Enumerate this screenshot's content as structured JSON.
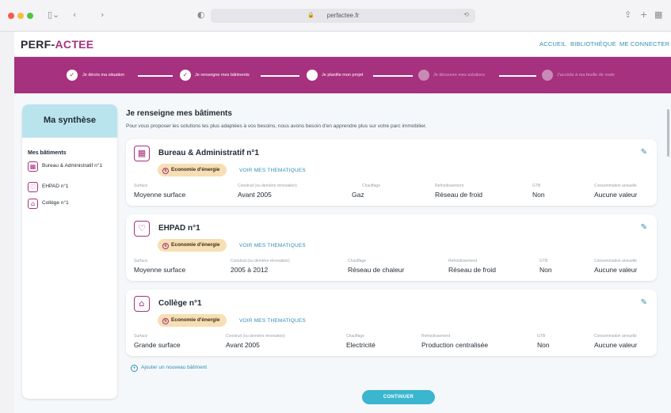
{
  "browser": {
    "url": "perfactee.fr",
    "icons": [
      "sidebar-icon",
      "chevron-left-icon",
      "chevron-right-icon",
      "shield-icon",
      "translate-icon",
      "reload-icon",
      "share-icon",
      "new-tab-icon",
      "tab-overview-icon"
    ]
  },
  "header": {
    "logo_main": "PERF-",
    "logo_accent": "ACTEE",
    "nav": [
      "ACCUEIL",
      "BIBLIOTHÈQUE",
      "ME CONNECTER"
    ]
  },
  "stepper": {
    "steps": [
      {
        "label": "Je décris ma situation",
        "state": "done"
      },
      {
        "label": "Je renseigne mes bâtiments",
        "state": "done"
      },
      {
        "label": "Je planifie mon projet",
        "state": "current"
      },
      {
        "label": "Je découvre mes solutions",
        "state": "todo"
      },
      {
        "label": "J'accède à ma feuille de route",
        "state": "todo"
      }
    ]
  },
  "sidebar": {
    "title": "Ma synthèse",
    "section_title": "Mes bâtiments",
    "items": [
      {
        "label": "Bureau & Administratif n°1",
        "icon": "office-building-icon"
      },
      {
        "label": "EHPAD n°1",
        "icon": "care-home-icon"
      },
      {
        "label": "Collège n°1",
        "icon": "school-icon"
      }
    ]
  },
  "main": {
    "title": "Je renseigne mes bâtiments",
    "description": "Pour vous proposer les solutions les plus adaptées à vos besoins, nous avons besoin d'en apprendre plus sur votre parc immobilier.",
    "badge_label": "Economie d'énergie",
    "theme_link": "VOIR MES THEMATIQUES",
    "columns": [
      "Surface",
      "Construit (ou dernière rénovation)",
      "Chauffage",
      "Refroidissement",
      "GTB",
      "Consommation annuelle"
    ],
    "buildings": [
      {
        "title": "Bureau & Administratif n°1",
        "icon": "office-building-icon",
        "values": [
          "Moyenne surface",
          "Avant 2005",
          "Gaz",
          "Réseau de froid",
          "Non",
          "Aucune valeur"
        ]
      },
      {
        "title": "EHPAD n°1",
        "icon": "care-home-icon",
        "values": [
          "Moyenne surface",
          "2005 à 2012",
          "Réseau de chaleur",
          "Réseau de froid",
          "Non",
          "Aucune valeur"
        ]
      },
      {
        "title": "Collège n°1",
        "icon": "school-icon",
        "values": [
          "Grande surface",
          "Avant 2005",
          "Electricité",
          "Production centralisée",
          "Non",
          "Aucune valeur"
        ]
      }
    ],
    "add_link": "Ajouter un nouveau bâtiment",
    "continue_label": "CONTINUER"
  },
  "colors": {
    "brand_purple": "#a6317e",
    "accent_teal": "#3bb6cf",
    "link_blue": "#2e8fb5",
    "badge_bg": "#f6dfb4",
    "sidebar_header_bg": "#b9e4ee"
  }
}
